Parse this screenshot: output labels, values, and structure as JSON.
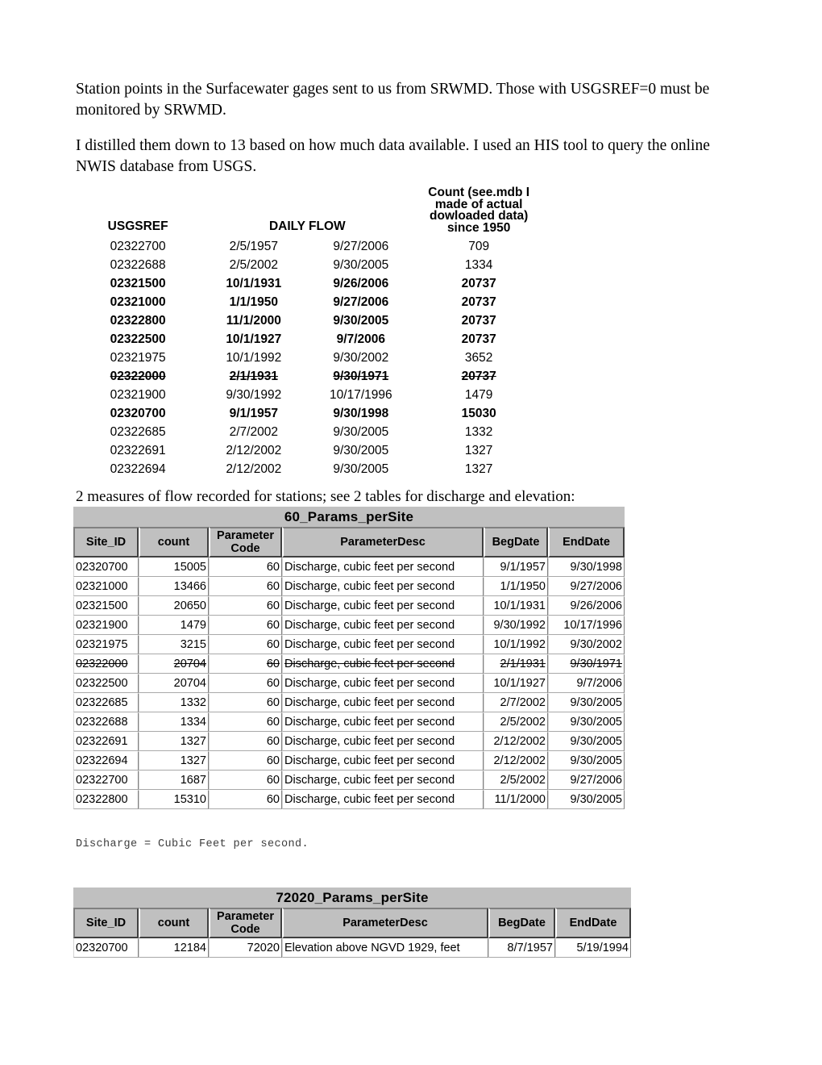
{
  "document": {
    "paragraphs": [
      "Station points in the Surfacewater gages sent to us from SRWMD. Those with USGSREF=0 must be monitored by SRWMD.",
      "I distilled them down to 13 based on how much data available. I used an HIS tool to query the online NWIS database from USGS.",
      "2 measures of flow recorded for stations; see 2 tables for discharge and elevation:"
    ],
    "mono_note": "Discharge = Cubic Feet per second."
  },
  "flow_table": {
    "headers": {
      "usgsref": "USGSREF",
      "daily_flow": "DAILY FLOW",
      "count_strong": "Count",
      "count_rest": " (see.mdb I made of actual dowloaded data) since 1950"
    },
    "rows": [
      {
        "site": "02322700",
        "beg": "2/5/1957",
        "end": "9/27/2006",
        "count": "709",
        "bold": false,
        "struck": false
      },
      {
        "site": "02322688",
        "beg": "2/5/2002",
        "end": "9/30/2005",
        "count": "1334",
        "bold": false,
        "struck": false
      },
      {
        "site": "02321500",
        "beg": "10/1/1931",
        "end": "9/26/2006",
        "count": "20737",
        "bold": true,
        "struck": false
      },
      {
        "site": "02321000",
        "beg": "1/1/1950",
        "end": "9/27/2006",
        "count": "20737",
        "bold": true,
        "struck": false
      },
      {
        "site": "02322800",
        "beg": "11/1/2000",
        "end": "9/30/2005",
        "count": "20737",
        "bold": true,
        "struck": false
      },
      {
        "site": "02322500",
        "beg": "10/1/1927",
        "end": "9/7/2006",
        "count": "20737",
        "bold": true,
        "struck": false
      },
      {
        "site": "02321975",
        "beg": "10/1/1992",
        "end": "9/30/2002",
        "count": "3652",
        "bold": false,
        "struck": false
      },
      {
        "site": "02322000",
        "beg": "2/1/1931",
        "end": "9/30/1971",
        "count": "20737",
        "bold": true,
        "struck": true
      },
      {
        "site": "02321900",
        "beg": "9/30/1992",
        "end": "10/17/1996",
        "count": "1479",
        "bold": false,
        "struck": false
      },
      {
        "site": "02320700",
        "beg": "9/1/1957",
        "end": "9/30/1998",
        "count": "15030",
        "bold": true,
        "struck": false
      },
      {
        "site": "02322685",
        "beg": "2/7/2002",
        "end": "9/30/2005",
        "count": "1332",
        "bold": false,
        "struck": false
      },
      {
        "site": "02322691",
        "beg": "2/12/2002",
        "end": "9/30/2005",
        "count": "1327",
        "bold": false,
        "struck": false
      },
      {
        "site": "02322694",
        "beg": "2/12/2002",
        "end": "9/30/2005",
        "count": "1327",
        "bold": false,
        "struck": false
      }
    ]
  },
  "table_60": {
    "title": "60_Params_perSite",
    "columns": [
      "Site_ID",
      "count",
      "Parameter Code",
      "ParameterDesc",
      "BegDate",
      "EndDate"
    ],
    "rows": [
      {
        "site_id": "02320700",
        "count": "15005",
        "param_code": "60",
        "param_desc": "Discharge, cubic feet per second",
        "beg_date": "9/1/1957",
        "end_date": "9/30/1998",
        "struck": false
      },
      {
        "site_id": "02321000",
        "count": "13466",
        "param_code": "60",
        "param_desc": "Discharge, cubic feet per second",
        "beg_date": "1/1/1950",
        "end_date": "9/27/2006",
        "struck": false
      },
      {
        "site_id": "02321500",
        "count": "20650",
        "param_code": "60",
        "param_desc": "Discharge, cubic feet per second",
        "beg_date": "10/1/1931",
        "end_date": "9/26/2006",
        "struck": false
      },
      {
        "site_id": "02321900",
        "count": "1479",
        "param_code": "60",
        "param_desc": "Discharge, cubic feet per second",
        "beg_date": "9/30/1992",
        "end_date": "10/17/1996",
        "struck": false
      },
      {
        "site_id": "02321975",
        "count": "3215",
        "param_code": "60",
        "param_desc": "Discharge, cubic feet per second",
        "beg_date": "10/1/1992",
        "end_date": "9/30/2002",
        "struck": false
      },
      {
        "site_id": "02322000",
        "count": "20704",
        "param_code": "60",
        "param_desc": "Discharge, cubic feet per second",
        "beg_date": "2/1/1931",
        "end_date": "9/30/1971",
        "struck": true
      },
      {
        "site_id": "02322500",
        "count": "20704",
        "param_code": "60",
        "param_desc": "Discharge, cubic feet per second",
        "beg_date": "10/1/1927",
        "end_date": "9/7/2006",
        "struck": false
      },
      {
        "site_id": "02322685",
        "count": "1332",
        "param_code": "60",
        "param_desc": "Discharge, cubic feet per second",
        "beg_date": "2/7/2002",
        "end_date": "9/30/2005",
        "struck": false
      },
      {
        "site_id": "02322688",
        "count": "1334",
        "param_code": "60",
        "param_desc": "Discharge, cubic feet per second",
        "beg_date": "2/5/2002",
        "end_date": "9/30/2005",
        "struck": false
      },
      {
        "site_id": "02322691",
        "count": "1327",
        "param_code": "60",
        "param_desc": "Discharge, cubic feet per second",
        "beg_date": "2/12/2002",
        "end_date": "9/30/2005",
        "struck": false
      },
      {
        "site_id": "02322694",
        "count": "1327",
        "param_code": "60",
        "param_desc": "Discharge, cubic feet per second",
        "beg_date": "2/12/2002",
        "end_date": "9/30/2005",
        "struck": false
      },
      {
        "site_id": "02322700",
        "count": "1687",
        "param_code": "60",
        "param_desc": "Discharge, cubic feet per second",
        "beg_date": "2/5/2002",
        "end_date": "9/27/2006",
        "struck": false
      },
      {
        "site_id": "02322800",
        "count": "15310",
        "param_code": "60",
        "param_desc": "Discharge, cubic feet per second",
        "beg_date": "11/1/2000",
        "end_date": "9/30/2005",
        "struck": false
      }
    ]
  },
  "table_72020": {
    "title": "72020_Params_perSite",
    "columns": [
      "Site_ID",
      "count",
      "Parameter Code",
      "ParameterDesc",
      "BegDate",
      "EndDate"
    ],
    "rows": [
      {
        "site_id": "02320700",
        "count": "12184",
        "param_code": "72020",
        "param_desc": "Elevation above NGVD 1929, feet",
        "beg_date": "8/7/1957",
        "end_date": "5/19/1994",
        "struck": false
      }
    ]
  }
}
